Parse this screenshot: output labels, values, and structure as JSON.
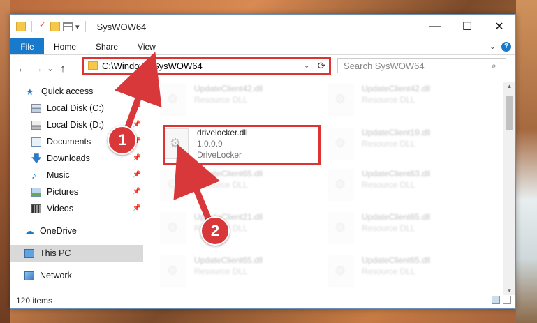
{
  "window": {
    "title": "SysWOW64",
    "caption": {
      "minimize": "—",
      "maximize": "☐",
      "close": "✕"
    }
  },
  "ribbon": {
    "tabs": [
      "File",
      "Home",
      "Share",
      "View"
    ],
    "expand_icon": "chevron-down-icon",
    "help_label": "?"
  },
  "nav": {
    "back": "←",
    "forward": "→",
    "recent": "⌄",
    "up": "↑",
    "address": "C:\\Windows\\SysWOW64",
    "search_placeholder": "Search SysWOW64"
  },
  "sidebar": {
    "items": [
      {
        "label": "Quick access",
        "icon": "star-icon",
        "pin": false
      },
      {
        "label": "Local Disk (C:)",
        "icon": "drive-icon",
        "pin": true
      },
      {
        "label": "Local Disk (D:)",
        "icon": "drive-icon",
        "pin": true
      },
      {
        "label": "Documents",
        "icon": "documents-icon",
        "pin": true
      },
      {
        "label": "Downloads",
        "icon": "download-icon",
        "pin": true
      },
      {
        "label": "Music",
        "icon": "music-icon",
        "pin": true
      },
      {
        "label": "Pictures",
        "icon": "pictures-icon",
        "pin": true
      },
      {
        "label": "Videos",
        "icon": "videos-icon",
        "pin": true
      },
      {
        "label": "OneDrive",
        "icon": "cloud-icon",
        "pin": false
      },
      {
        "label": "This PC",
        "icon": "computer-icon",
        "pin": false
      },
      {
        "label": "Network",
        "icon": "network-icon",
        "pin": false
      }
    ]
  },
  "files": [
    {
      "name": "UpdateClient42.dll",
      "type": "Resource DLL"
    },
    {
      "name": "UpdateClient42.dll",
      "type": "Resource DLL"
    },
    {
      "name": "drivelocker.dll",
      "version": "1.0.0.9",
      "type": "DriveLocker"
    },
    {
      "name": "UpdateClient19.dll",
      "type": "Resource DLL"
    },
    {
      "name": "UpdateClient65.dll",
      "type": "Resource DLL"
    },
    {
      "name": "UpdateClient63.dll",
      "type": "Resource DLL"
    },
    {
      "name": "UpdateClient21.dll",
      "type": "Resource DLL"
    },
    {
      "name": "UpdateClient65.dll",
      "type": "Resource DLL"
    },
    {
      "name": "UpdateClient65.dll",
      "type": "Resource DLL"
    },
    {
      "name": "UpdateClient65.dll",
      "type": "Resource DLL"
    }
  ],
  "status": {
    "item_count": "120 items"
  },
  "annotations": {
    "step1": "1",
    "step2": "2"
  },
  "colors": {
    "accent": "#1979ca",
    "highlight": "#d33333"
  }
}
